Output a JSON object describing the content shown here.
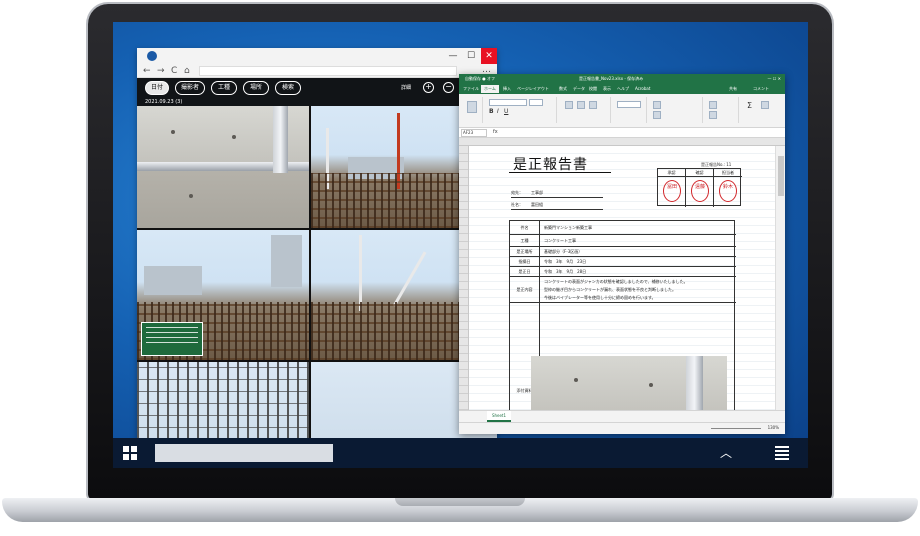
{
  "browser": {
    "window_controls": {
      "minimize": "—",
      "maximize": "☐",
      "close": "✕"
    },
    "nav": {
      "back": "←",
      "forward": "→",
      "reload": "C",
      "home": "⌂",
      "menu": "…"
    },
    "app_bar": {
      "filters": [
        {
          "label": "日付",
          "active": true
        },
        {
          "label": "撮影者",
          "active": false
        },
        {
          "label": "工種",
          "active": false
        },
        {
          "label": "場所",
          "active": false
        },
        {
          "label": "検索",
          "active": false
        }
      ],
      "detail_label": "詳細",
      "zoom_in": "+",
      "zoom_out": "−"
    },
    "date_header": "2021.09.23 (3)"
  },
  "excel": {
    "title_left": "自動保存 ● オフ",
    "title_center": "是正報告書_Nov23.xlsx  -  保存済み",
    "title_buttons": "— ☐ ✕",
    "menu_tabs": [
      "ファイル",
      "ホーム",
      "挿入",
      "ページレイアウト",
      "数式",
      "データ",
      "校閲",
      "表示",
      "ヘルプ",
      "Acrobat"
    ],
    "active_tab": "ホーム",
    "share_label": "共有",
    "comment_label": "コメント",
    "name_box": "AF23",
    "formula_symbol": "fx",
    "sheet_tab": "Sheet1",
    "zoom": "130%",
    "document": {
      "title": "是正報告書",
      "number": "是正報告No.: 11",
      "addressee_label": "宛先：",
      "addressee": "工事部",
      "from_label": "社名：",
      "from": "富田組",
      "stamps": [
        {
          "role": "承認",
          "name": "冨田"
        },
        {
          "role": "確認",
          "name": "遠藤"
        },
        {
          "role": "担当者",
          "name": "鈴木"
        }
      ],
      "rows": [
        {
          "label": "件名",
          "value": "新築門マンション新築工事"
        },
        {
          "label": "工種",
          "value": "コンクリート工事"
        },
        {
          "label": "是正場所",
          "value": "基礎部分（F-3区画）"
        },
        {
          "label": "指摘日",
          "value": "令和　3年　9月　23日"
        },
        {
          "label": "是正日",
          "value": "令和　3年　9月　28日"
        },
        {
          "label": "是正内容",
          "value": "コンクリートの表面がジャンカの状態を確認しましたので、補修いたしました。"
        },
        {
          "label": "",
          "value": "型枠の継ぎ目からコンクリートが漏れ、表面状態を不良と判断しました。"
        },
        {
          "label": "",
          "value": "今後はバイブレーター等を使用し十分に締め固めを行います。"
        },
        {
          "label": "添付資料",
          "value": ""
        }
      ]
    }
  },
  "colors": {
    "excel_green": "#217346",
    "seal_red": "#d2282c",
    "desktop_blue": "#1561b3",
    "close_red": "#e81123"
  }
}
